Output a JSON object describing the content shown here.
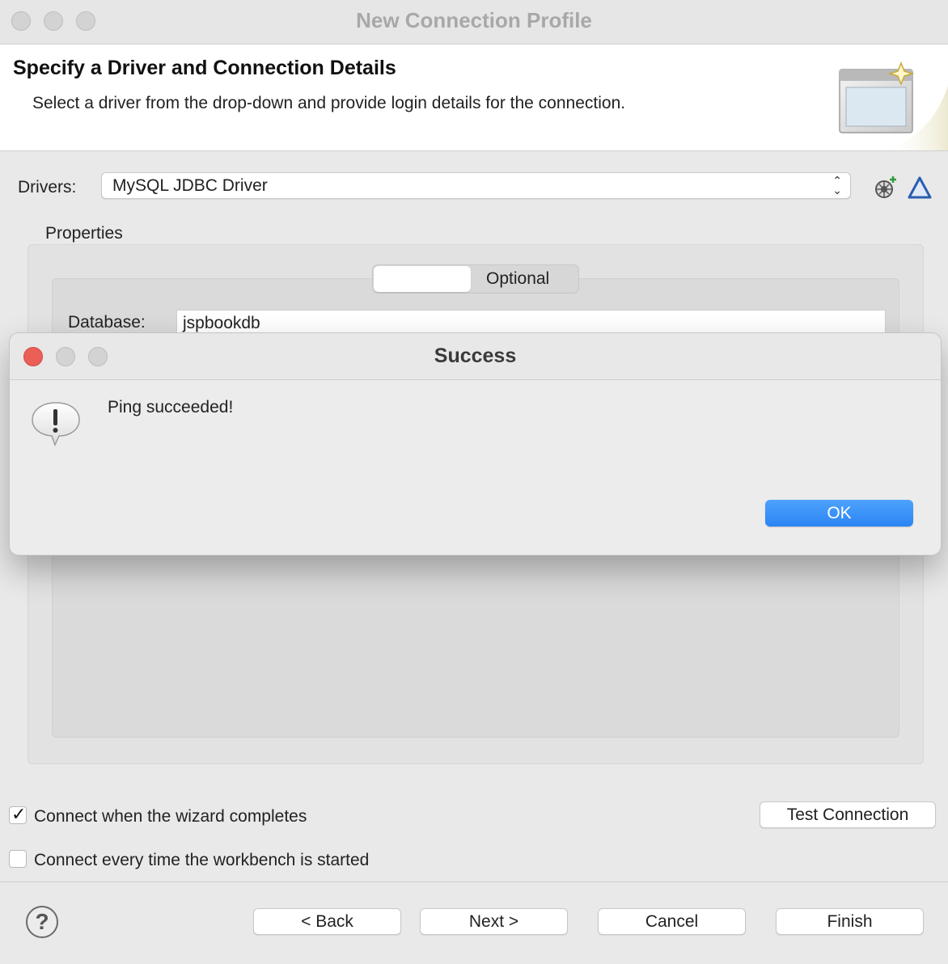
{
  "window": {
    "title": "New Connection Profile"
  },
  "header": {
    "title": "Specify a Driver and Connection Details",
    "description": "Select a driver from the drop-down and provide login details for the connection."
  },
  "drivers": {
    "label": "Drivers:",
    "selected": "MySQL JDBC Driver"
  },
  "properties": {
    "label": "Properties",
    "tabs": [
      {
        "label": ""
      },
      {
        "label": "Optional"
      }
    ],
    "database": {
      "label": "Database:",
      "value": "jspbookdb"
    }
  },
  "dialog": {
    "title": "Success",
    "message": "Ping succeeded!",
    "ok_label": "OK"
  },
  "options": {
    "connect_on_complete": {
      "label": "Connect when the wizard completes",
      "checked": true
    },
    "connect_on_start": {
      "label": "Connect every time the workbench is started",
      "checked": false
    }
  },
  "buttons": {
    "test_connection": "Test Connection",
    "back": "< Back",
    "next": "Next >",
    "cancel": "Cancel",
    "finish": "Finish",
    "help": "?"
  },
  "colors": {
    "ok_button": "#2b84f5",
    "close_light": "#ec5f57"
  }
}
